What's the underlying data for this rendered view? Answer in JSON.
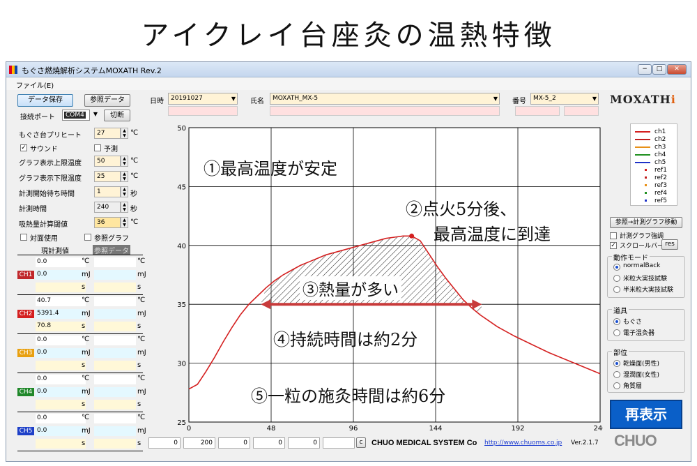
{
  "slide_title": "アイクレイ台座灸の温熱特徴",
  "window": {
    "title": "もぐさ燃焼解析システムMOXATH  Rev.2",
    "min": "−",
    "max": "□",
    "close": "✕"
  },
  "menu": {
    "file": "ファイル(E)"
  },
  "toolbar": {
    "save_label": "データ保存",
    "ref_label": "参照データ",
    "port_label": "接続ポート",
    "port_value": "COM4",
    "disconnect_label": "切断",
    "date_label": "日時",
    "date_value": "20191027",
    "name_label": "氏名",
    "name_value": "MOXATH_MX-5",
    "number_label": "番号",
    "number_value": "MX-5_2",
    "logo": "MOXATH",
    "logo_mark": "i"
  },
  "settings": {
    "preheat_label": "もぐさ台プリヒート",
    "preheat_value": "27",
    "sound_label": "サウンド",
    "predict_label": "予測",
    "graph_upper_label": "グラフ表示上限温度",
    "graph_upper_value": "50",
    "graph_lower_label": "グラフ表示下限温度",
    "graph_lower_value": "25",
    "wait_label": "計測開始待ち時間",
    "wait_value": "1",
    "duration_label": "計測時間",
    "duration_value": "240",
    "threshold_label": "吸熱量計算閾値",
    "threshold_value": "36",
    "opposite_label": "対面使用",
    "refgraph_label": "参照グラフ",
    "current_label": "現計測値",
    "refdata_label": "参照データ",
    "unit_c": "℃",
    "unit_s": "秒",
    "unit_mj": "mJ",
    "unit_sec": "s"
  },
  "channels": [
    {
      "name": "CH1",
      "color": "#c0282c",
      "temp": "0.0",
      "heat": "0.0",
      "time": ""
    },
    {
      "name": "CH2",
      "color": "#d42020",
      "temp": "40.7",
      "heat": "5391.4",
      "time": "70.8"
    },
    {
      "name": "CH3",
      "color": "#e8a010",
      "temp": "0.0",
      "heat": "0.0",
      "time": ""
    },
    {
      "name": "CH4",
      "color": "#20882a",
      "temp": "0.0",
      "heat": "0.0",
      "time": ""
    },
    {
      "name": "CH5",
      "color": "#1e40c8",
      "temp": "0.0",
      "heat": "0.0",
      "time": ""
    }
  ],
  "right_panel": {
    "legend": [
      "ch1",
      "ch2",
      "ch3",
      "ch4",
      "ch5",
      "ref1",
      "ref2",
      "ref3",
      "ref4",
      "ref5"
    ],
    "legend_colors": [
      "#d42020",
      "#c02020",
      "#e89018",
      "#209020",
      "#1e32c8",
      "#d42020",
      "#c02020",
      "#e89018",
      "#209020",
      "#1e32c8"
    ],
    "move_button": "参照→計測グラフ移動",
    "emphasize_label": "計測グラフ強調",
    "scrollbar_label": "スクロールバー",
    "res_button": "res",
    "mode_title": "動作モード",
    "modes": [
      "normalBack",
      "米粒大実技試験",
      "半米粒大実技試験"
    ],
    "tool_title": "道具",
    "tools": [
      "もぐさ",
      "電子温灸器"
    ],
    "site_title": "部位",
    "sites": [
      "乾燥面(男性)",
      "湿潤面(女性)",
      "角質層"
    ],
    "redisplay_button": "再表示",
    "chuo_logo": "CHUO"
  },
  "footer": {
    "fields": [
      "0",
      "200",
      "0",
      "0",
      "0",
      ""
    ],
    "c_button": "c",
    "company": "CHUO MEDICAL SYSTEM Co",
    "url": "http://www.chuoms.co.jp",
    "version": "Ver.2.1.7"
  },
  "annotations": {
    "a1": "①最高温度が安定",
    "a2_line1": "②点火5分後、",
    "a2_line2": "最高温度に到達",
    "a3": "③熱量が多い",
    "a4": "④持続時間は約2分",
    "a5": "⑤一粒の施灸時間は約6分"
  },
  "chart_data": {
    "type": "line",
    "xlim": [
      0,
      240
    ],
    "ylim": [
      25,
      50
    ],
    "x_ticks": [
      "0",
      "48",
      "96",
      "144",
      "192",
      "240"
    ],
    "y_ticks": [
      "25",
      "30",
      "35",
      "40",
      "45",
      "50"
    ],
    "grid": true,
    "series": [
      {
        "name": "ch2",
        "color": "#d42020",
        "x": [
          0,
          5,
          10,
          15,
          20,
          25,
          30,
          35,
          40,
          45,
          50,
          55,
          60,
          65,
          70,
          75,
          80,
          85,
          90,
          95,
          100,
          105,
          110,
          115,
          120,
          125,
          130,
          135,
          140,
          145,
          150,
          155,
          160,
          165,
          170,
          175,
          180,
          190,
          200,
          210,
          220,
          230,
          240
        ],
        "y": [
          27.8,
          28.2,
          29.3,
          30.5,
          31.8,
          33.0,
          34.1,
          35.0,
          35.7,
          36.4,
          37.0,
          37.5,
          37.9,
          38.3,
          38.6,
          38.9,
          39.2,
          39.4,
          39.6,
          39.8,
          40.0,
          40.2,
          40.4,
          40.6,
          40.7,
          40.8,
          40.8,
          40.4,
          39.3,
          38.2,
          37.2,
          36.3,
          35.4,
          34.7,
          34.1,
          33.6,
          33.1,
          32.3,
          31.6,
          30.9,
          30.3,
          29.7,
          29.1
        ]
      }
    ],
    "peak": {
      "x": 130,
      "y": 40.8
    },
    "shaded_region": {
      "x_from": 42,
      "x_to": 171,
      "threshold": 35
    },
    "duration_arrow": {
      "x_from": 42,
      "x_to": 171,
      "y": 35
    }
  }
}
